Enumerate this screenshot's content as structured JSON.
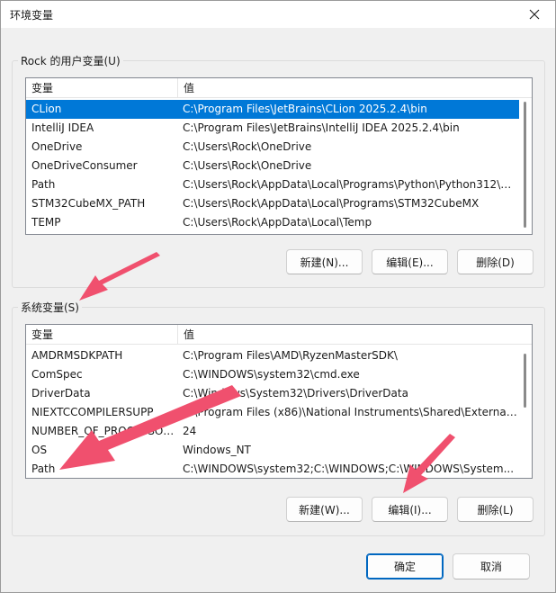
{
  "window": {
    "title": "环境变量",
    "close_icon": "close-icon"
  },
  "user_vars": {
    "group_label": "Rock 的用户变量(U)",
    "col_variable": "变量",
    "col_value": "值",
    "rows": [
      {
        "name": "CLion",
        "value": "C:\\Program Files\\JetBrains\\CLion 2025.2.4\\bin",
        "selected": true
      },
      {
        "name": "IntelliJ IDEA",
        "value": "C:\\Program Files\\JetBrains\\IntelliJ IDEA 2025.2.4\\bin"
      },
      {
        "name": "OneDrive",
        "value": "C:\\Users\\Rock\\OneDrive"
      },
      {
        "name": "OneDriveConsumer",
        "value": "C:\\Users\\Rock\\OneDrive"
      },
      {
        "name": "Path",
        "value": "C:\\Users\\Rock\\AppData\\Local\\Programs\\Python\\Python312\\S..."
      },
      {
        "name": "STM32CubeMX_PATH",
        "value": "C:\\Users\\Rock\\AppData\\Local\\Programs\\STM32CubeMX"
      },
      {
        "name": "TEMP",
        "value": "C:\\Users\\Rock\\AppData\\Local\\Temp"
      }
    ],
    "new_label": "新建(N)...",
    "edit_label": "编辑(E)...",
    "delete_label": "删除(D)"
  },
  "system_vars": {
    "group_label": "系统变量(S)",
    "col_variable": "变量",
    "col_value": "值",
    "rows": [
      {
        "name": "AMDRMSDKPATH",
        "value": "C:\\Program Files\\AMD\\RyzenMasterSDK\\"
      },
      {
        "name": "ComSpec",
        "value": "C:\\WINDOWS\\system32\\cmd.exe"
      },
      {
        "name": "DriverData",
        "value": "C:\\Windows\\System32\\Drivers\\DriverData"
      },
      {
        "name": "NIEXTCCOMPILERSUPP",
        "value": "C:\\Program Files (x86)\\National Instruments\\Shared\\External..."
      },
      {
        "name": "NUMBER_OF_PROCESSORS",
        "value": "24"
      },
      {
        "name": "OS",
        "value": "Windows_NT"
      },
      {
        "name": "Path",
        "value": "C:\\WINDOWS\\system32;C:\\WINDOWS;C:\\WINDOWS\\System..."
      }
    ],
    "new_label": "新建(W)...",
    "edit_label": "编辑(I)...",
    "delete_label": "删除(L)"
  },
  "footer": {
    "ok_label": "确定",
    "cancel_label": "取消"
  },
  "colors": {
    "selection": "#0078d7",
    "annotation_arrow": "#f0506e",
    "primary_border": "#0067c0"
  }
}
